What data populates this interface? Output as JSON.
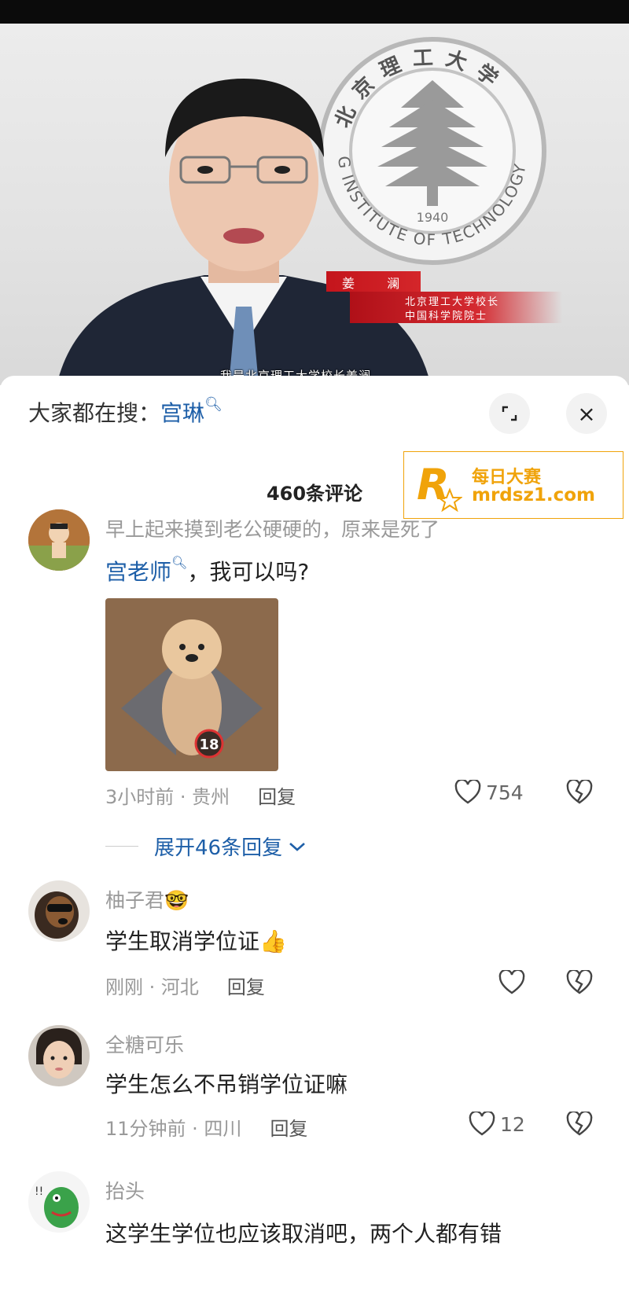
{
  "video": {
    "seal_text_top": "北京理工大学",
    "seal_text_bottom": "G INSTITUTE OF TECHNOLOGY",
    "seal_year": "1940",
    "name_card": {
      "name": "姜 澜",
      "title1": "北京理工大学校长",
      "title2": "中国科学院院士"
    },
    "subtitle": "我是北京理工大学校长姜澜"
  },
  "panel": {
    "search_prefix": "大家都在搜：",
    "search_keyword": "宫琳",
    "comment_count": "460条评论",
    "watermark_line1": "每日大赛",
    "watermark_line2": "mrdsz1.com",
    "close_symbol": "×"
  },
  "comments": [
    {
      "username": "早上起来摸到老公硬硬的，原来是死了",
      "mention": "宫老师",
      "text": "，我可以吗?",
      "sticker_badge": "18",
      "time_location": "3小时前 · 贵州",
      "reply_label": "回复",
      "likes": "754",
      "expand_label": "展开46条回复"
    },
    {
      "username": "柚子君",
      "username_emoji": "🤓",
      "text": "学生取消学位证",
      "text_emoji": "👍",
      "time_location": "刚刚 · 河北",
      "reply_label": "回复",
      "likes": ""
    },
    {
      "username": "全糖可乐",
      "text": "学生怎么不吊销学位证嘛",
      "time_location": "11分钟前 · 四川",
      "reply_label": "回复",
      "likes": "12"
    },
    {
      "username": "抬头",
      "text": "这学生学位也应该取消吧，两个人都有错"
    }
  ]
}
